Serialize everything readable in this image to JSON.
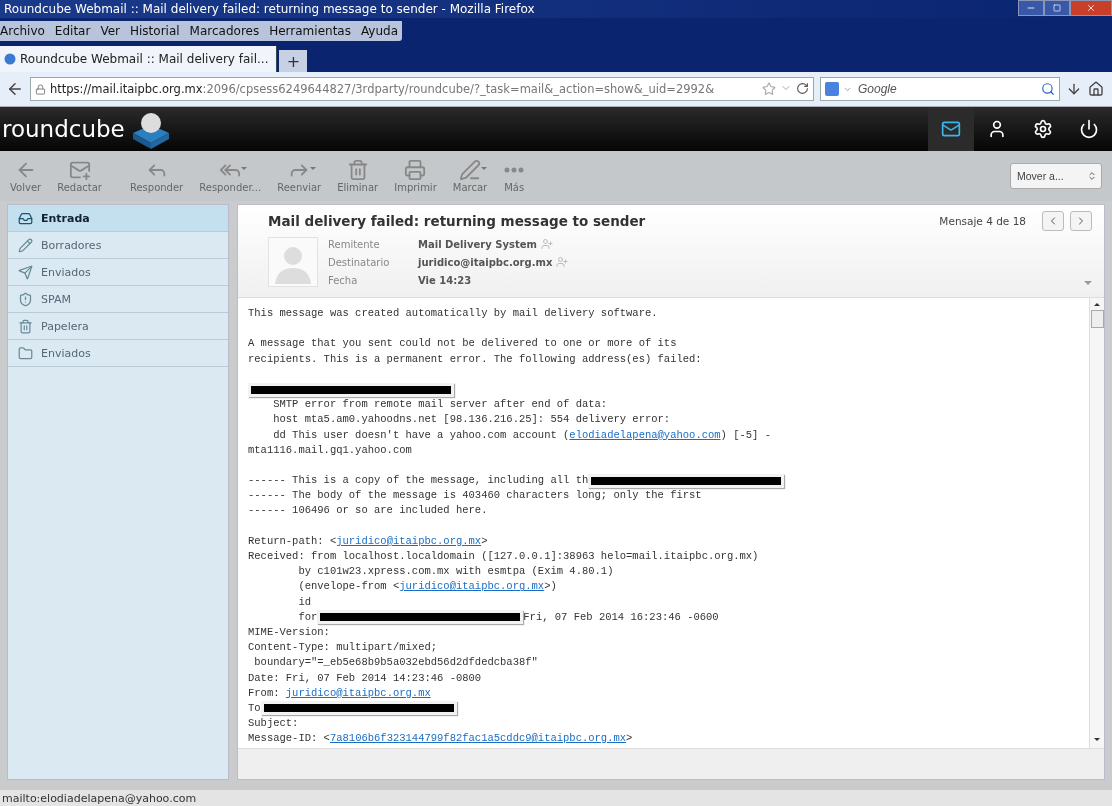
{
  "window": {
    "title": "Roundcube Webmail :: Mail delivery failed: returning message to sender - Mozilla Firefox"
  },
  "menu": [
    "Archivo",
    "Editar",
    "Ver",
    "Historial",
    "Marcadores",
    "Herramientas",
    "Ayuda"
  ],
  "tabs": [
    {
      "label": "Roundcube Webmail :: Mail delivery fail...",
      "selected": true
    }
  ],
  "new_tab": "+",
  "address_bar": {
    "host": "https://mail.itaipbc.org.mx",
    "path": ":2096/cpsess6249644827/3rdparty/roundcube/?_task=mail&_action=show&_uid=2992&"
  },
  "search": {
    "placeholder": "Google"
  },
  "app": {
    "logo": "roundcube",
    "switcher": [
      {
        "kind": "mail",
        "selected": true
      },
      {
        "kind": "contacts",
        "selected": false
      },
      {
        "kind": "settings",
        "selected": false
      },
      {
        "kind": "logout",
        "selected": false
      }
    ]
  },
  "toolbar": [
    {
      "kind": "back",
      "label": "Volver",
      "dropdown": false
    },
    {
      "kind": "compose",
      "label": "Redactar",
      "dropdown": false
    },
    {
      "kind": "reply",
      "label": "Responder",
      "dropdown": false
    },
    {
      "kind": "reply_all",
      "label": "Responder...",
      "dropdown": true
    },
    {
      "kind": "forward",
      "label": "Reenviar",
      "dropdown": true
    },
    {
      "kind": "delete",
      "label": "Eliminar",
      "dropdown": false
    },
    {
      "kind": "print",
      "label": "Imprimir",
      "dropdown": false
    },
    {
      "kind": "mark",
      "label": "Marcar",
      "dropdown": true
    },
    {
      "kind": "more",
      "label": "Más",
      "dropdown": false
    }
  ],
  "move_select": {
    "value": "Mover a..."
  },
  "folders": [
    {
      "kind": "inbox",
      "name": "Entrada",
      "selected": true
    },
    {
      "kind": "drafts",
      "name": "Borradores",
      "selected": false
    },
    {
      "kind": "sent",
      "name": "Enviados",
      "selected": false
    },
    {
      "kind": "spam",
      "name": "SPAM",
      "selected": false
    },
    {
      "kind": "trash",
      "name": "Papelera",
      "selected": false
    },
    {
      "kind": "folder",
      "name": "Enviados",
      "selected": false
    }
  ],
  "message": {
    "subject": "Mail delivery failed: returning message to sender",
    "counter": "Mensaje 4 de 18",
    "headers": [
      {
        "label": "Remitente",
        "value": "Mail Delivery System",
        "add_contact": true
      },
      {
        "label": "Destinatario",
        "value": "juridico@itaipbc.org.mx",
        "add_contact": true
      },
      {
        "label": "Fecha",
        "value": "Vie 14:23",
        "add_contact": false
      }
    ],
    "body": [
      [
        {
          "kind": "text",
          "text": "This message was created automatically by mail delivery software."
        }
      ],
      [
        {
          "kind": "blank"
        }
      ],
      [
        {
          "kind": "text",
          "text": "A message that you sent could not be delivered to one or more of its"
        }
      ],
      [
        {
          "kind": "text",
          "text": "recipients. This is a permanent error. The following address(es) failed:"
        }
      ],
      [
        {
          "kind": "blank"
        }
      ],
      [
        {
          "kind": "redaction"
        }
      ],
      [
        {
          "kind": "text",
          "text": "    SMTP error from remote mail server after end of data:"
        }
      ],
      [
        {
          "kind": "text",
          "text": "    host mta5.am0.yahoodns.net [98.136.216.25]: 554 delivery error:"
        }
      ],
      [
        {
          "kind": "text",
          "text": "    dd This user doesn't have a yahoo.com account ("
        },
        {
          "kind": "link",
          "text": "elodiadelapena@yahoo.com"
        },
        {
          "kind": "text",
          "text": ") [-5] -"
        }
      ],
      [
        {
          "kind": "text",
          "text": "mta1116.mail.gq1.yahoo.com"
        }
      ],
      [
        {
          "kind": "blank"
        }
      ],
      [
        {
          "kind": "text",
          "text": "------ This is a copy of the message, including all th"
        },
        {
          "kind": "redaction"
        }
      ],
      [
        {
          "kind": "text",
          "text": "------ The body of the message is 403460 characters long; only the first"
        }
      ],
      [
        {
          "kind": "text",
          "text": "------ 106496 or so are included here."
        }
      ],
      [
        {
          "kind": "blank"
        }
      ],
      [
        {
          "kind": "text",
          "text": "Return-path: <"
        },
        {
          "kind": "link",
          "text": "juridico@itaipbc.org.mx"
        },
        {
          "kind": "text",
          "text": ">"
        }
      ],
      [
        {
          "kind": "text",
          "text": "Received: from localhost.localdomain ([127.0.0.1]:38963 helo=mail.itaipbc.org.mx)"
        }
      ],
      [
        {
          "kind": "text",
          "text": "        by c101w23.xpress.com.mx with esmtpa (Exim 4.80.1)"
        }
      ],
      [
        {
          "kind": "text",
          "text": "        (envelope-from <"
        },
        {
          "kind": "link",
          "text": "juridico@itaipbc.org.mx"
        },
        {
          "kind": "text",
          "text": ">)"
        }
      ],
      [
        {
          "kind": "text",
          "text": "        id"
        }
      ],
      [
        {
          "kind": "text",
          "text": "        for"
        },
        {
          "kind": "redaction"
        },
        {
          "kind": "text",
          "text": "Fri, 07 Feb 2014 16:23:46 -0600"
        }
      ],
      [
        {
          "kind": "text",
          "text": "MIME-Version:"
        }
      ],
      [
        {
          "kind": "text",
          "text": "Content-Type: multipart/mixed;"
        }
      ],
      [
        {
          "kind": "text",
          "text": " boundary=\"=_eb5e68b9b5a032ebd56d2dfdedcba38f\""
        }
      ],
      [
        {
          "kind": "text",
          "text": "Date: Fri, 07 Feb 2014 14:23:46 -0800"
        }
      ],
      [
        {
          "kind": "text",
          "text": "From: "
        },
        {
          "kind": "link",
          "text": "juridico@itaipbc.org.mx"
        }
      ],
      [
        {
          "kind": "text",
          "text": "To"
        },
        {
          "kind": "redaction"
        }
      ],
      [
        {
          "kind": "text",
          "text": "Subject:"
        }
      ],
      [
        {
          "kind": "text",
          "text": "Message-ID: <"
        },
        {
          "kind": "link",
          "text": "7a8106b6f323144799f82fac1a5cddc9@itaipbc.org.mx"
        },
        {
          "kind": "text",
          "text": ">"
        }
      ]
    ]
  },
  "status_bar": "mailto:elodiadelapena@yahoo.com"
}
